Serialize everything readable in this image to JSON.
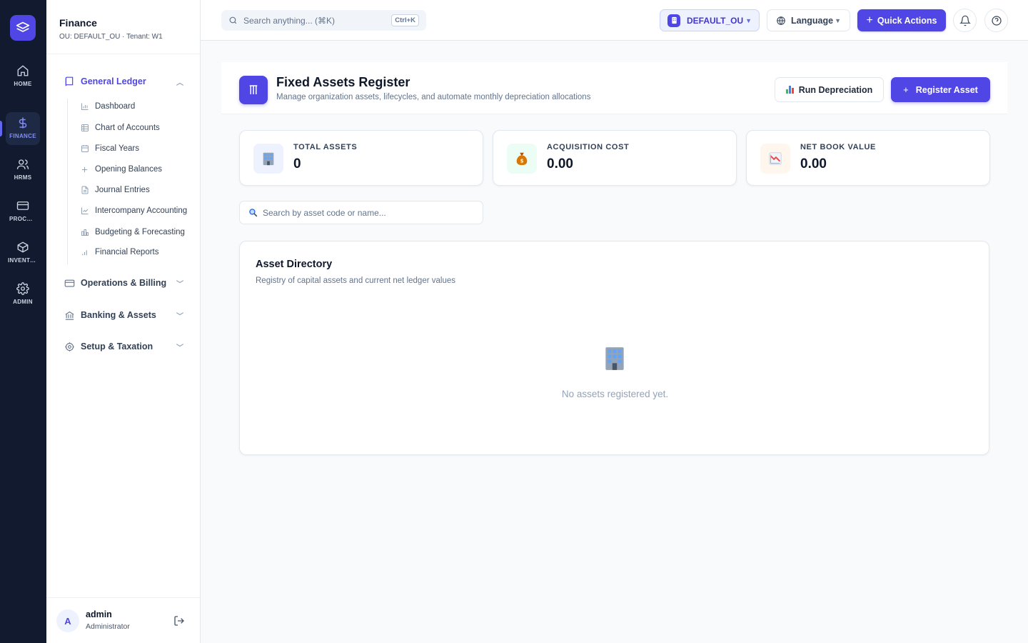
{
  "rail": {
    "items": [
      {
        "label": "HOME",
        "icon": "home-icon"
      },
      {
        "label": "FINANCE",
        "icon": "dollar-icon"
      },
      {
        "label": "HRMS",
        "icon": "users-icon"
      },
      {
        "label": "PROCUREMENT",
        "icon": "credit-card-icon"
      },
      {
        "label": "INVENTORY",
        "icon": "box-icon"
      },
      {
        "label": "ADMIN",
        "icon": "gear-icon"
      }
    ]
  },
  "sidebar": {
    "title": "Finance",
    "subtitle": "OU: DEFAULT_OU · Tenant: W1",
    "groups": [
      {
        "label": "General Ledger",
        "expanded": true
      },
      {
        "label": "Operations & Billing",
        "expanded": false
      },
      {
        "label": "Banking & Assets",
        "expanded": false
      },
      {
        "label": "Setup & Taxation",
        "expanded": false
      }
    ],
    "gl_items": [
      "Dashboard",
      "Chart of Accounts",
      "Fiscal Years",
      "Opening Balances",
      "Journal Entries",
      "Intercompany Accounting",
      "Budgeting & Forecasting",
      "Financial Reports"
    ],
    "user": {
      "initial": "A",
      "name": "admin",
      "role": "Administrator"
    }
  },
  "topbar": {
    "search_placeholder": "Search anything... (⌘K)",
    "search_shortcut": "Ctrl+K",
    "ou_label": "DEFAULT_OU",
    "language_label": "Language",
    "quick_actions_label": "Quick Actions"
  },
  "page": {
    "title": "Fixed Assets Register",
    "subtitle": "Manage organization assets, lifecycles, and automate monthly depreciation allocations",
    "run_depreciation_label": "Run Depreciation",
    "register_asset_label": "Register Asset"
  },
  "stats": [
    {
      "label": "TOTAL ASSETS",
      "value": "0",
      "icon": "building-icon"
    },
    {
      "label": "ACQUISITION COST",
      "value": "0.00",
      "icon": "money-bag-icon"
    },
    {
      "label": "NET BOOK VALUE",
      "value": "0.00",
      "icon": "chart-down-icon"
    }
  ],
  "asset_search_placeholder": "Search by asset code or name...",
  "directory": {
    "title": "Asset Directory",
    "subtitle": "Registry of capital assets and current net ledger values",
    "empty_text": "No assets registered yet."
  },
  "colors": {
    "primary": "#4f46e5",
    "rail_bg": "#111a2f",
    "page_bg": "#f8fafc"
  }
}
